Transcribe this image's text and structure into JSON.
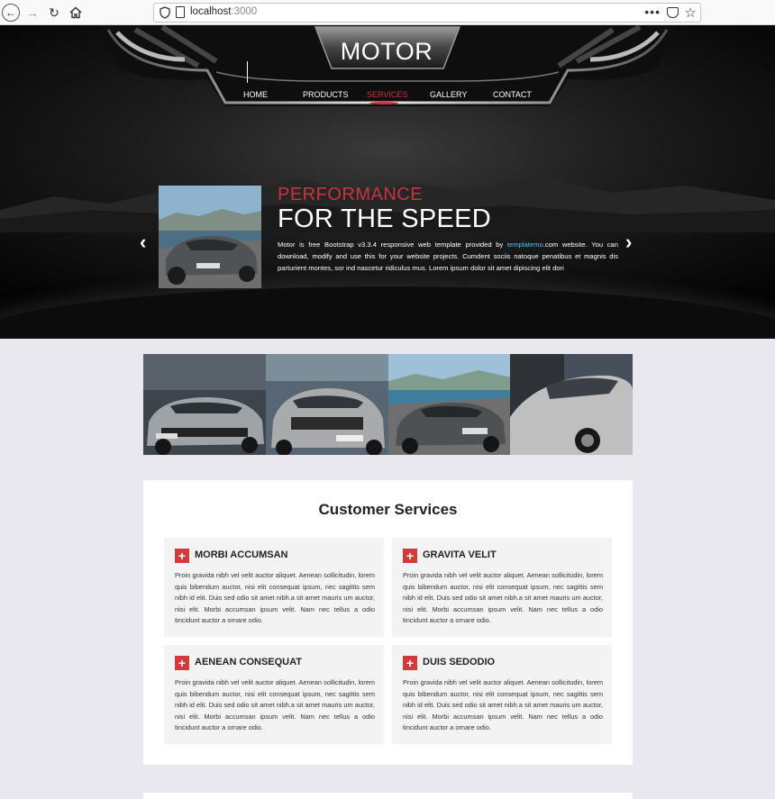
{
  "browser": {
    "url_host": "localhost",
    "url_port": ":3000",
    "icons": [
      "back-icon",
      "forward-icon",
      "reload-icon",
      "home-icon",
      "shield-icon",
      "page-icon",
      "more-icon",
      "pocket-icon",
      "star-icon"
    ]
  },
  "header": {
    "brand": "MOTOR",
    "nav": [
      {
        "label": "HOME",
        "active": false
      },
      {
        "label": "PRODUCTS",
        "active": false
      },
      {
        "label": "SERVICES",
        "active": true
      },
      {
        "label": "GALLERY",
        "active": false
      },
      {
        "label": "CONTACT",
        "active": false
      }
    ]
  },
  "slider": {
    "subtitle": "PERFORMANCE",
    "title": "FOR THE SPEED",
    "text_before": "Motor is free Bootstrap v3.3.4 responsive web template provided by ",
    "link_text": "templatemo",
    "text_after": ".com website. You can download, modify and use this for your website projects. Cumdent sociis natoque penatibus et magnis dis parturient montes, sor ind nascetur ridiculus mus. Lorem ipsum dolor sit amet dipiscing elit dori",
    "prev_icon": "chevron-left-icon",
    "next_icon": "chevron-right-icon"
  },
  "services": {
    "title": "Customer Services",
    "cards": [
      {
        "title": "MORBI ACCUMSAN",
        "text": "Proin gravida nibh vel velit auctor aliquet. Aenean sollicitudin, lorem quis bibendum auctor, nisi elit consequat ipsum, nec sagittis sem nibh id elit. Duis sed odio sit amet nibh.a sit amet mauris um auctor, nisi elit. Morbi accumsan ipsum velit. Nam nec tellus a odio tincidunt auctor a ornare odio."
      },
      {
        "title": "GRAVITA VELIT",
        "text": "Proin gravida nibh vel velit auctor aliquet. Aenean sollicitudin, lorem quis bibendum auctor, nisi elit consequat ipsum, nec sagittis sem nibh id elit. Duis sed odio sit amet nibh.a sit amet mauris um auctor, nisi elit. Morbi accumsan ipsum velit. Nam nec tellus a odio tincidunt auctor a ornare odio."
      },
      {
        "title": "AENEAN CONSEQUAT",
        "text": "Proin gravida nibh vel velit auctor aliquet. Aenean sollicitudin, lorem quis bibendum auctor, nisi elit consequat ipsum, nec sagittis sem nibh id elit. Duis sed odio sit amet nibh.a sit amet mauris um auctor, nisi elit. Morbi accumsan ipsum velit. Nam nec tellus a odio tincidunt auctor a ornare odio."
      },
      {
        "title": "DUIS SEDODIO",
        "text": "Proin gravida nibh vel velit auctor aliquet. Aenean sollicitudin, lorem quis bibendum auctor, nisi elit consequat ipsum, nec sagittis sem nibh id elit. Duis sed odio sit amet nibh.a sit amet mauris um auctor, nisi elit. Morbi accumsan ipsum velit. Nam nec tellus a odio tincidunt auctor a ornare odio."
      }
    ]
  },
  "colors": {
    "accent_red": "#c8343f",
    "icon_red": "#d33b3b",
    "link_blue": "#4fc3f7",
    "page_bg": "#e9e8ee"
  }
}
